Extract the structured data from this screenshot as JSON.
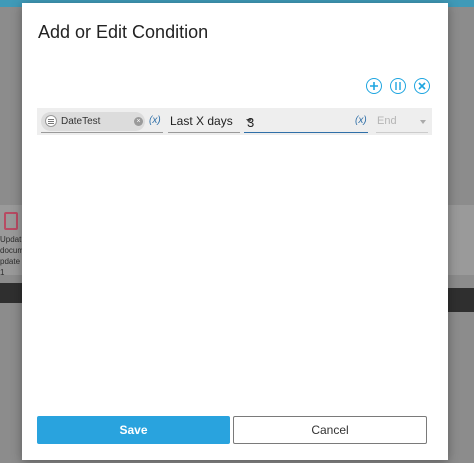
{
  "background": {
    "left_card_text": "Updat documn pdate 1"
  },
  "dialog": {
    "title": "Add or Edit Condition",
    "actions": {
      "add_icon": "plus-circle-icon",
      "group_icon": "bracket-circle-icon",
      "remove_icon": "x-circle-icon"
    },
    "condition": {
      "field_label": "DateTest",
      "field_var": "(x)",
      "operator": "Last X days",
      "value": "3",
      "value_var": "(x)",
      "end_placeholder": "End"
    },
    "buttons": {
      "save": "Save",
      "cancel": "Cancel"
    }
  },
  "colors": {
    "accent": "#29a3de",
    "icon_blue": "#1ea5e0",
    "var_blue": "#2f6fa8"
  }
}
